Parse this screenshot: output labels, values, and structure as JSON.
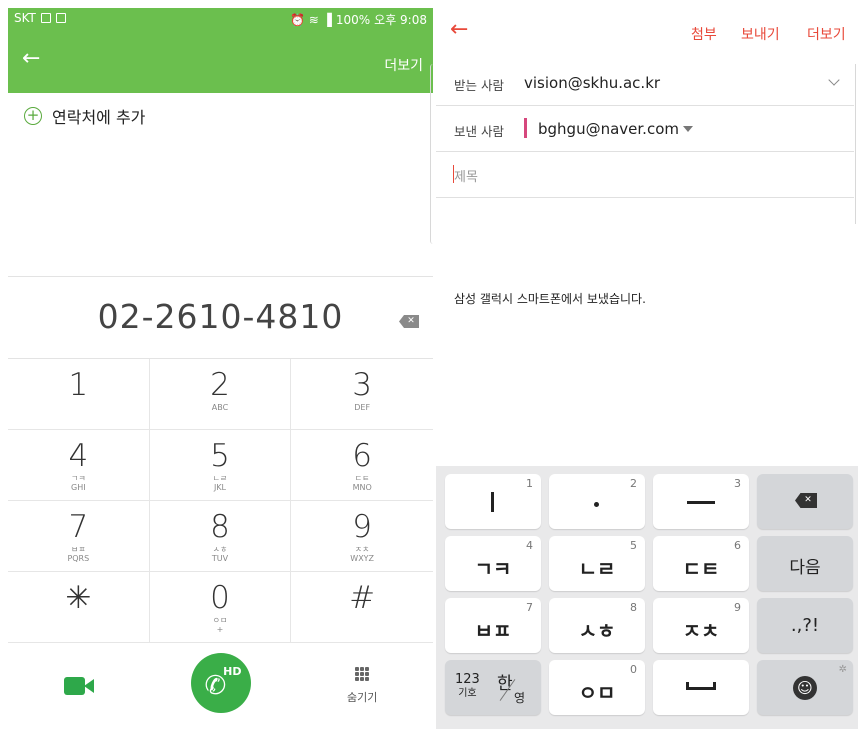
{
  "left": {
    "status": {
      "carrier": "SKT",
      "battery": "100%",
      "time": "오후 9:08",
      "icons": "⏰ ≋ ▐"
    },
    "appbar": {
      "back_icon": "←",
      "more_label": "더보기"
    },
    "add_contact_label": "연락처에 추가",
    "phone_number": "02-2610-4810",
    "keys": [
      {
        "num": "1",
        "sub": "",
        "sub2": ""
      },
      {
        "num": "2",
        "sub": "",
        "sub2": "ABC"
      },
      {
        "num": "3",
        "sub": "",
        "sub2": "DEF"
      },
      {
        "num": "4",
        "sub": "ㄱㅋ",
        "sub2": "GHI"
      },
      {
        "num": "5",
        "sub": "ㄴㄹ",
        "sub2": "JKL"
      },
      {
        "num": "6",
        "sub": "ㄷㅌ",
        "sub2": "MNO"
      },
      {
        "num": "7",
        "sub": "ㅂㅍ",
        "sub2": "PQRS"
      },
      {
        "num": "8",
        "sub": "ㅅㅎ",
        "sub2": "TUV"
      },
      {
        "num": "9",
        "sub": "ㅈㅊ",
        "sub2": "WXYZ"
      },
      {
        "num": "✳",
        "sub": "",
        "sub2": ""
      },
      {
        "num": "0",
        "sub": "ㅇㅁ",
        "sub2": "+"
      },
      {
        "num": "#",
        "sub": "",
        "sub2": ""
      }
    ],
    "call_hd_label": "HD",
    "hide_label": "숨기기",
    "accent_color": "#6bbf4e"
  },
  "right": {
    "topbar": {
      "back_icon": "←",
      "attach": "첨부",
      "send": "보내기",
      "more": "더보기"
    },
    "to": {
      "label": "받는 사람",
      "value": "vision@skhu.ac.kr"
    },
    "from": {
      "label": "보낸 사람",
      "value": "bghgu@naver.com"
    },
    "subject_placeholder": "제목",
    "signature": "삼성 갤럭시 스마트폰에서 보냈습니다.",
    "accent_color": "#e8493a",
    "keyboard": {
      "keys": [
        {
          "main": "ㅣ",
          "hint": "1"
        },
        {
          "main": "·",
          "hint": "2"
        },
        {
          "main": "ㅡ",
          "hint": "3"
        },
        {
          "main": "",
          "hint": ""
        },
        {
          "main": "ㄱㅋ",
          "hint": "4"
        },
        {
          "main": "ㄴㄹ",
          "hint": "5"
        },
        {
          "main": "ㄷㅌ",
          "hint": "6"
        },
        {
          "main": "다음",
          "hint": ""
        },
        {
          "main": "ㅂㅍ",
          "hint": "7"
        },
        {
          "main": "ㅅㅎ",
          "hint": "8"
        },
        {
          "main": "ㅈㅊ",
          "hint": "9"
        },
        {
          "main": ".,?!",
          "hint": ""
        },
        {
          "main": "",
          "hint": ""
        },
        {
          "main": "ㅇㅁ",
          "hint": "0"
        },
        {
          "main": "",
          "hint": ""
        },
        {
          "main": "",
          "hint": ""
        }
      ],
      "mode_label": "123",
      "mode_sub": "기호",
      "lang_a": "한",
      "lang_b": "영"
    }
  }
}
